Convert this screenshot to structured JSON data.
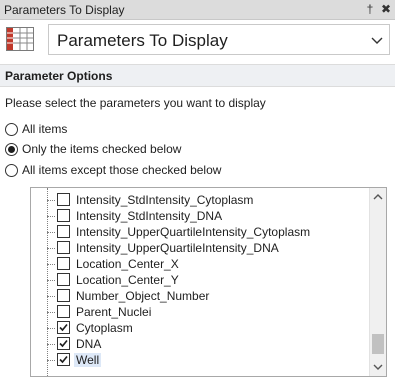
{
  "window": {
    "title": "Parameters To Display",
    "pin_glyph": "†",
    "close_glyph": "✖"
  },
  "selector": {
    "icon": "table-grid-icon",
    "value": "Parameters To Display"
  },
  "section": {
    "title": "Parameter Options"
  },
  "instruction": "Please select the parameters you want to display",
  "radio_options": [
    {
      "label": "All items",
      "checked": false
    },
    {
      "label": "Only the items checked below",
      "checked": true
    },
    {
      "label": "All items except those checked below",
      "checked": false
    }
  ],
  "parameters": [
    {
      "label": "Intensity_StdIntensity_Cytoplasm",
      "checked": false
    },
    {
      "label": "Intensity_StdIntensity_DNA",
      "checked": false
    },
    {
      "label": "Intensity_UpperQuartileIntensity_Cytoplasm",
      "checked": false
    },
    {
      "label": "Intensity_UpperQuartileIntensity_DNA",
      "checked": false
    },
    {
      "label": "Location_Center_X",
      "checked": false
    },
    {
      "label": "Location_Center_Y",
      "checked": false
    },
    {
      "label": "Number_Object_Number",
      "checked": false
    },
    {
      "label": "Parent_Nuclei",
      "checked": false
    },
    {
      "label": "Cytoplasm",
      "checked": true
    },
    {
      "label": "DNA",
      "checked": true
    },
    {
      "label": "Well",
      "checked": true,
      "selected": true
    }
  ],
  "scrollbar": {
    "position_fraction": 0.92
  }
}
